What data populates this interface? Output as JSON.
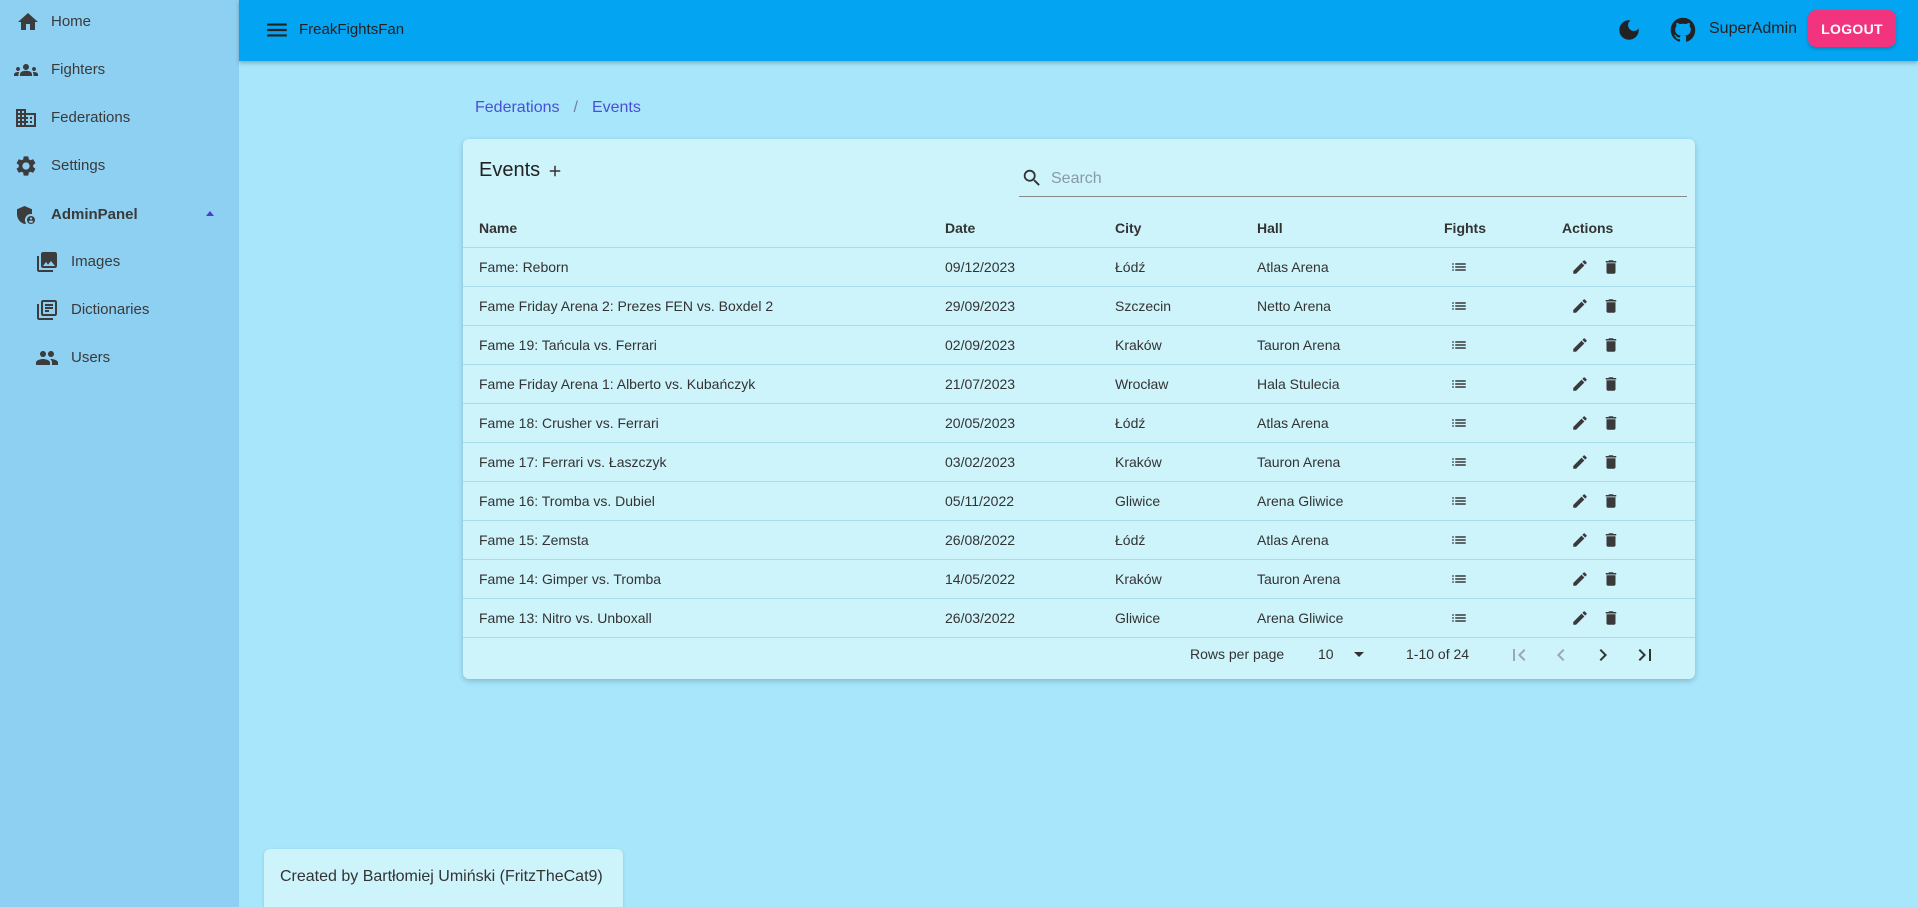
{
  "sidebar": {
    "items": [
      {
        "label": "Home",
        "icon": "home-icon"
      },
      {
        "label": "Fighters",
        "icon": "groups-icon"
      },
      {
        "label": "Federations",
        "icon": "building-icon"
      },
      {
        "label": "Settings",
        "icon": "gear-icon"
      },
      {
        "label": "AdminPanel",
        "icon": "admin-shield-icon"
      },
      {
        "label": "Images",
        "icon": "images-icon"
      },
      {
        "label": "Dictionaries",
        "icon": "library-books-icon"
      },
      {
        "label": "Users",
        "icon": "people-icon"
      }
    ]
  },
  "header": {
    "app_title": "FreakFightsFan",
    "user": "SuperAdmin",
    "logout_label": "LOGOUT"
  },
  "breadcrumb": {
    "items": [
      "Federations",
      "Events"
    ],
    "separator": "/"
  },
  "events": {
    "title": "Events",
    "search_placeholder": "Search",
    "columns": [
      "Name",
      "Date",
      "City",
      "Hall",
      "Fights",
      "Actions"
    ],
    "rows": [
      {
        "name": "Fame: Reborn",
        "date": "09/12/2023",
        "city": "Łódź",
        "hall": "Atlas Arena"
      },
      {
        "name": "Fame Friday Arena 2: Prezes FEN vs. Boxdel 2",
        "date": "29/09/2023",
        "city": "Szczecin",
        "hall": "Netto Arena"
      },
      {
        "name": "Fame 19: Tańcula vs. Ferrari",
        "date": "02/09/2023",
        "city": "Kraków",
        "hall": "Tauron Arena"
      },
      {
        "name": "Fame Friday Arena 1: Alberto vs. Kubańczyk",
        "date": "21/07/2023",
        "city": "Wrocław",
        "hall": "Hala Stulecia"
      },
      {
        "name": "Fame 18: Crusher vs. Ferrari",
        "date": "20/05/2023",
        "city": "Łódź",
        "hall": "Atlas Arena"
      },
      {
        "name": "Fame 17: Ferrari vs. Łaszczyk",
        "date": "03/02/2023",
        "city": "Kraków",
        "hall": "Tauron Arena"
      },
      {
        "name": "Fame 16: Tromba vs. Dubiel",
        "date": "05/11/2022",
        "city": "Gliwice",
        "hall": "Arena Gliwice"
      },
      {
        "name": "Fame 15: Zemsta",
        "date": "26/08/2022",
        "city": "Łódź",
        "hall": "Atlas Arena"
      },
      {
        "name": "Fame 14: Gimper vs. Tromba",
        "date": "14/05/2022",
        "city": "Kraków",
        "hall": "Tauron Arena"
      },
      {
        "name": "Fame 13: Nitro vs. Unboxall",
        "date": "26/03/2022",
        "city": "Gliwice",
        "hall": "Arena Gliwice"
      }
    ]
  },
  "pagination": {
    "rows_per_page_label": "Rows per page",
    "rows_per_page": "10",
    "range": "1-10 of 24"
  },
  "footer": {
    "credit": "Created by Bartłomiej Umiński (FritzTheCat9)"
  },
  "colors": {
    "topbar": "#03a4f1",
    "sidebar": "#8ed0f2",
    "page_bg": "#a7e6fb",
    "card_bg": "#cdf3fb",
    "logout": "#f2347f",
    "link": "#4a4fd8"
  }
}
